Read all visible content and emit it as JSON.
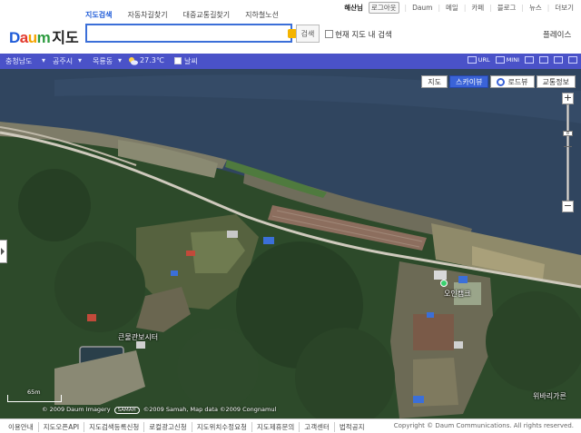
{
  "header": {
    "logo_brand": "Daum",
    "logo_service": "지도",
    "service_tabs": [
      {
        "label": "지도검색",
        "active": true
      },
      {
        "label": "자동차길찾기",
        "active": false
      },
      {
        "label": "대중교통길찾기",
        "active": false
      },
      {
        "label": "지하철노선",
        "active": false
      }
    ],
    "search": {
      "value": "",
      "placeholder": "",
      "button": "검색"
    },
    "map_search_checkbox": "현재 지도 내 검색",
    "places_link": "플레이스",
    "top_links": {
      "user": "해산님",
      "logout": "로그아웃",
      "links": [
        "Daum",
        "메일",
        "카페",
        "블로그",
        "뉴스",
        "더보기"
      ]
    }
  },
  "location_bar": {
    "province": "충청남도",
    "city": "공주시",
    "district": "목룡동",
    "temperature": "27.3℃",
    "night_label": "날씨"
  },
  "toolbar": {
    "items": [
      "URL",
      "MINI"
    ]
  },
  "map": {
    "type_tabs": [
      {
        "label": "지도",
        "active": false
      },
      {
        "label": "스카이뷰",
        "active": true
      },
      {
        "label": "로드뷰",
        "active": false
      },
      {
        "label": "교통정보",
        "active": false
      }
    ],
    "zoom": {
      "in": "+",
      "out": "−",
      "level": "8"
    },
    "pois": {
      "center": "큰물관보시터",
      "east": "오인캠크",
      "southeast": "위바리가른"
    },
    "scale": "65m",
    "copyright": {
      "prefix": "© 2009 Daum",
      "imagery": "Imagery",
      "provider": "SAMAH",
      "suffix": "©2009 Samah, Map data ©2009 Congnamul"
    }
  },
  "footer": {
    "links": [
      "이용안내",
      "지도오픈API",
      "지도검색등록신청",
      "로컬광고신청",
      "지도위치수정요청",
      "지도제휴문의",
      "고객센터",
      "법적공지"
    ],
    "copyright": "Copyright © Daum Communications. All rights reserved."
  },
  "colors": {
    "brand_blue": "#1e5bd8",
    "location_bar": "#4a52c8",
    "river": "#30455f",
    "forest": "#2d4a2a"
  }
}
